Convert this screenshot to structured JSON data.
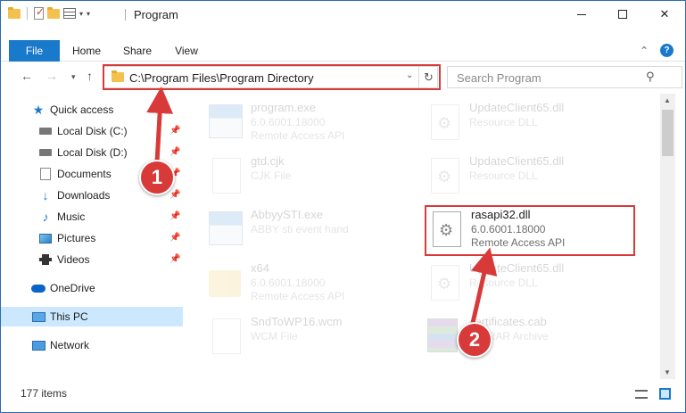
{
  "window": {
    "title": "Program"
  },
  "ribbon": {
    "tabs": [
      {
        "label": "File"
      },
      {
        "label": "Home"
      },
      {
        "label": "Share"
      },
      {
        "label": "View"
      }
    ],
    "help_label": "?"
  },
  "address": {
    "path": "C:\\Program Files\\Program Directory"
  },
  "search": {
    "placeholder": "Search Program"
  },
  "sidebar": {
    "items": [
      {
        "label": "Quick access",
        "icon": "star-icon"
      },
      {
        "label": "Local Disk (C:)",
        "icon": "drive-icon",
        "pinned": true
      },
      {
        "label": "Local Disk (D:)",
        "icon": "drive-icon",
        "pinned": true
      },
      {
        "label": "Documents",
        "icon": "documents-icon",
        "pinned": true
      },
      {
        "label": "Downloads",
        "icon": "downloads-icon",
        "pinned": true
      },
      {
        "label": "Music",
        "icon": "music-icon",
        "pinned": true
      },
      {
        "label": "Pictures",
        "icon": "pictures-icon",
        "pinned": true
      },
      {
        "label": "Videos",
        "icon": "videos-icon",
        "pinned": true
      },
      {
        "label": "OneDrive",
        "icon": "cloud-icon"
      },
      {
        "label": "This PC",
        "icon": "computer-icon",
        "selected": true
      },
      {
        "label": "Network",
        "icon": "network-icon"
      }
    ]
  },
  "files": [
    {
      "name": "program.exe",
      "line2": "6.0.6001.18000",
      "line3": "Remote Access API",
      "icon": "exe-icon",
      "faded": true
    },
    {
      "name": "UpdateClient65.dll",
      "line2": "Resource DLL",
      "line3": "",
      "icon": "dll-icon",
      "faded": true
    },
    {
      "name": "gtd.cjk",
      "line2": "CJK File",
      "line3": "",
      "icon": "document-icon",
      "faded": true
    },
    {
      "name": "UpdateClient65.dll",
      "line2": "Resource DLL",
      "line3": "",
      "icon": "dll-icon",
      "faded": true
    },
    {
      "name": "AbbyySTI.exe",
      "line2": "ABBY sti event hand",
      "line3": "",
      "icon": "exe-icon",
      "faded": true
    },
    {
      "name": "rasapi32.dll",
      "line2": "6.0.6001.18000",
      "line3": "Remote Access API",
      "icon": "dll-icon",
      "faded": false
    },
    {
      "name": "x64",
      "line2": "6.0.6001.18000",
      "line3": "Remote Access API",
      "icon": "folder-icon",
      "faded": true
    },
    {
      "name": "UpdateClient65.dll",
      "line2": "Resource DLL",
      "line3": "",
      "icon": "dll-icon",
      "faded": true
    },
    {
      "name": "SndToWP16.wcm",
      "line2": "WCM File",
      "line3": "",
      "icon": "document-icon",
      "faded": true
    },
    {
      "name": "certificates.cab",
      "line2": "WinRAR Archive",
      "line3": "",
      "icon": "archive-icon",
      "faded": true
    }
  ],
  "status": {
    "item_count": "177 items"
  },
  "annotations": {
    "step1": "1",
    "step2": "2",
    "color": "#d83a3a"
  }
}
